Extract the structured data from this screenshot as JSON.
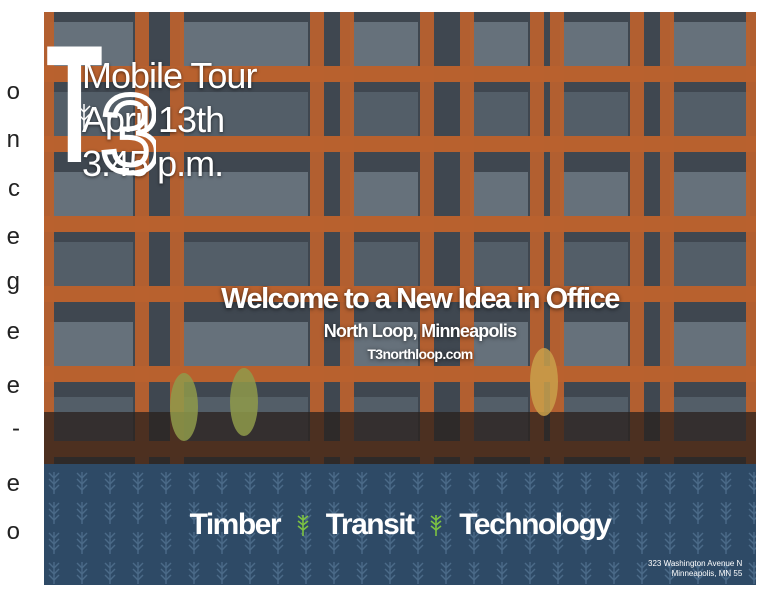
{
  "left_column": {
    "glyphs": [
      "o",
      "n",
      "c",
      "e",
      "g",
      "e",
      "e",
      "-",
      "e",
      "o"
    ]
  },
  "poster": {
    "tour": {
      "line1": "Mobile Tour",
      "line2": "April 13th",
      "line3": "3:45 p.m."
    },
    "logo": {
      "letter_t": "T",
      "digit": "3"
    },
    "headline": "Welcome to a New Idea in Office",
    "location": "North Loop, Minneapolis",
    "website": "T3northloop.com",
    "tagline": {
      "word1": "Timber",
      "word2": "Transit",
      "word3": "Technology"
    },
    "address": {
      "line1": "323 Washington Avenue N",
      "line2": "Minneapolis, MN 55"
    },
    "colors": {
      "banner": "#2e4a66",
      "accent_green": "#7cc242",
      "timber": "#b8612e"
    }
  }
}
